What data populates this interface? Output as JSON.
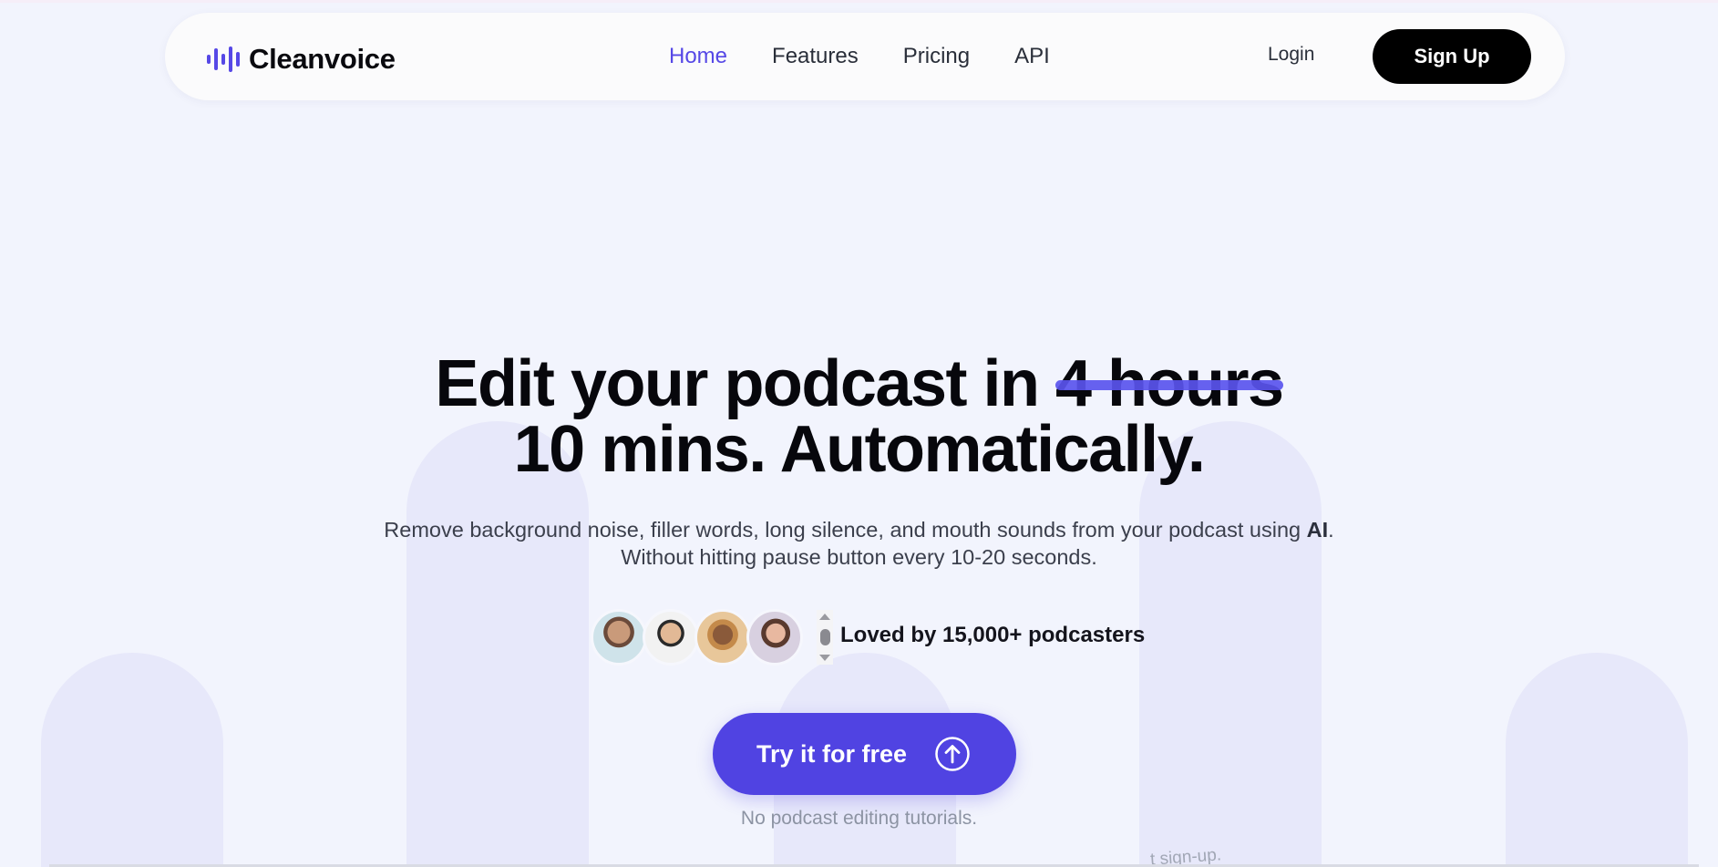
{
  "brand": {
    "name": "Cleanvoice",
    "accent_color": "#5648e6",
    "logo_icon": "sound-wave-icon"
  },
  "nav": {
    "items": [
      {
        "label": "Home",
        "active": true
      },
      {
        "label": "Features",
        "active": false
      },
      {
        "label": "Pricing",
        "active": false
      },
      {
        "label": "API",
        "active": false
      }
    ],
    "login_label": "Login",
    "signup_label": "Sign Up"
  },
  "hero": {
    "headline_prefix": "Edit your podcast in",
    "headline_struck": "4 hours",
    "headline_line2": "10 mins. Automatically.",
    "subtitle_part1": "Remove background noise, filler words, long silence, and mouth sounds from your podcast using",
    "subtitle_bold": "AI",
    "subtitle_part2": ".",
    "subtitle_line2": "Without hitting pause button every 10-20 seconds.",
    "social_proof": "Loved by 15,000+ podcasters",
    "cta_label": "Try it for free",
    "cta_icon": "arrow-up-circle-icon",
    "cta_note": "No podcast editing tutorials.",
    "partial_text": "t sign-up."
  }
}
